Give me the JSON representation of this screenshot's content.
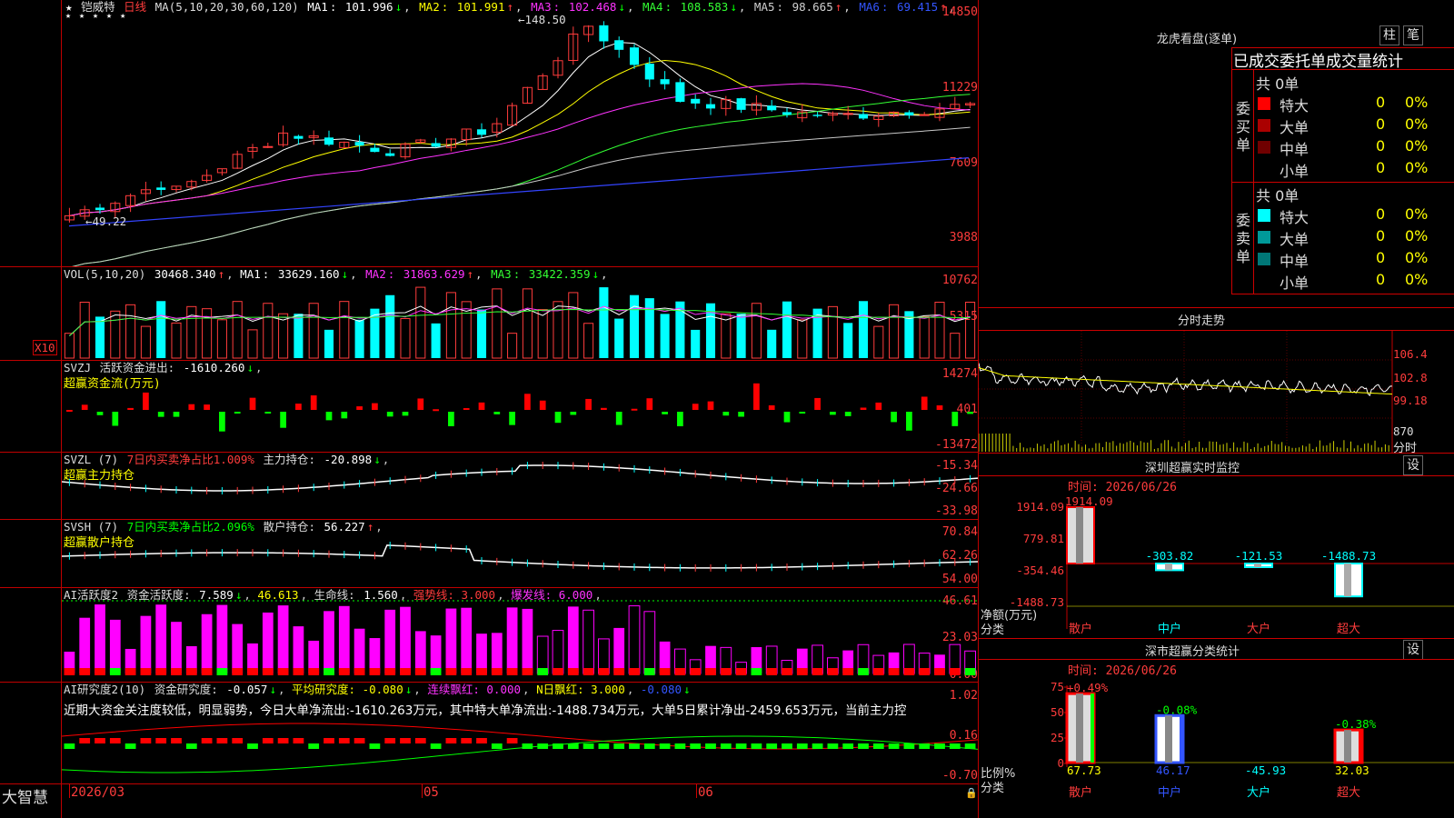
{
  "stock": {
    "name": "铠威特",
    "period": "日线",
    "ma_label": "MA(5,10,20,30,60,120)",
    "ma": [
      {
        "name": "MA1",
        "value": "101.996",
        "arrow": "↓",
        "color": "#ffffff"
      },
      {
        "name": "MA2",
        "value": "101.991",
        "arrow": "↑",
        "color": "#ffff00"
      },
      {
        "name": "MA3",
        "value": "102.468",
        "arrow": "↓",
        "color": "#ff33ff"
      },
      {
        "name": "MA4",
        "value": "108.583",
        "arrow": "↓",
        "color": "#33ff33"
      },
      {
        "name": "MA5",
        "value": "98.665",
        "arrow": "↑",
        "color": "#d0d0d0"
      },
      {
        "name": "MA6",
        "value": "69.415",
        "arrow": "↑",
        "color": "#3355ff"
      }
    ],
    "price_axis": [
      "14850",
      "11229",
      "7609",
      "3988"
    ],
    "high_label": "148.50",
    "low_label": "49.22",
    "stars": "★"
  },
  "vol": {
    "label": "VOL(5,10,20)",
    "value": "30468.340",
    "arrow": "↑",
    "ma": [
      {
        "name": "MA1",
        "value": "33629.160",
        "arrow": "↓",
        "color": "#ffffff"
      },
      {
        "name": "MA2",
        "value": "31863.629",
        "arrow": "↑",
        "color": "#ff33ff"
      },
      {
        "name": "MA3",
        "value": "33422.359",
        "arrow": "↓",
        "color": "#33ff33"
      }
    ],
    "axis": [
      "10762",
      "5315"
    ],
    "unit": "X10"
  },
  "svzj": {
    "label": "SVZJ",
    "title": "活跃资金进出:",
    "value": "-1610.260",
    "arrow": "↓",
    "sub": "超赢资金流(万元)",
    "axis": [
      "14274",
      "401",
      "-13472"
    ]
  },
  "svzl": {
    "label": "SVZL (7)",
    "desc": "7日内买卖净占比1.009%",
    "title": "主力持仓:",
    "value": "-20.898",
    "arrow": "↓",
    "sub": "超赢主力持仓",
    "axis": [
      "-15.34",
      "-24.66",
      "-33.98"
    ]
  },
  "svsh": {
    "label": "SVSH (7)",
    "desc": "7日内买卖净占比2.096%",
    "title": "散户持仓:",
    "value": "56.227",
    "arrow": "↑",
    "sub": "超赢散户持仓",
    "axis": [
      "70.84",
      "62.26",
      "54.00"
    ]
  },
  "ai1": {
    "label": "AI活跃度2",
    "title": "资金活跃度:",
    "value": "7.589",
    "arrow": "↓",
    "v2": "46.613",
    "life_label": "生命线:",
    "life_value": "1.560",
    "strong": "强势线: 3.000",
    "burst": "爆发线: 6.000",
    "axis": [
      "46.61",
      "23.03",
      "0.00"
    ]
  },
  "ai2": {
    "label": "AI研究度2(10)",
    "title": "资金研究度:",
    "value": "-0.057",
    "arrow": "↓",
    "avg": "平均研究度: -0.080",
    "cont": "连续飘红: 0.000",
    "nday": "N日飘红: 3.000",
    "last": "-0.080",
    "axis": [
      "1.02",
      "0.16",
      "-0.70"
    ],
    "comment": "近期大资金关注度较低，明显弱势，今日大单净流出:-1610.263万元，其中特大单净流出:-1488.734万元，大单5日累计净出-2459.653万元，当前主力控"
  },
  "footer": {
    "brand": "大智慧",
    "dates": [
      "2026/03",
      "05",
      "06"
    ]
  },
  "longhu": {
    "title": "龙虎看盘(逐单)",
    "btn1": "柱",
    "btn2": "笔",
    "subtitle": "已成交委托单成交量统计",
    "buy_label": "委买单",
    "sell_label": "委卖单",
    "buy_total": "共 0单",
    "sell_total": "共 0单",
    "buy_rows": [
      {
        "label": "特大",
        "count": "0",
        "pct": "0%",
        "color": "#ff0000"
      },
      {
        "label": "大单",
        "count": "0",
        "pct": "0%",
        "color": "#aa0000"
      },
      {
        "label": "中单",
        "count": "0",
        "pct": "0%",
        "color": "#700000"
      },
      {
        "label": "小单",
        "count": "0",
        "pct": "0%",
        "color": ""
      }
    ],
    "sell_rows": [
      {
        "label": "特大",
        "count": "0",
        "pct": "0%",
        "color": "#00ffff"
      },
      {
        "label": "大单",
        "count": "0",
        "pct": "0%",
        "color": "#009999"
      },
      {
        "label": "中单",
        "count": "0",
        "pct": "0%",
        "color": "#007777"
      },
      {
        "label": "小单",
        "count": "0",
        "pct": "0%",
        "color": ""
      }
    ]
  },
  "fenshi": {
    "title": "分时走势",
    "axis": [
      "106.4",
      "102.8",
      "99.18",
      "870"
    ],
    "bottom_label": "分时"
  },
  "sz_monitor": {
    "title": "深圳超赢实时监控",
    "btn": "设",
    "time": "时间: 2026/06/26",
    "axis": [
      "1914.09",
      "779.81",
      "-354.46",
      "-1488.73"
    ],
    "unit_label": "净额(万元)",
    "cat_label": "分类",
    "bars": [
      {
        "name": "散户",
        "value": 1914.09,
        "label": "1914.09"
      },
      {
        "name": "中户",
        "value": -303.82,
        "label": "-303.82"
      },
      {
        "name": "大户",
        "value": -121.53,
        "label": "-121.53"
      },
      {
        "name": "超大",
        "value": -1488.73,
        "label": "-1488.73"
      }
    ]
  },
  "sz_stats": {
    "title": "深市超赢分类统计",
    "btn": "设",
    "time": "时间: 2026/06/26",
    "axis": [
      "75",
      "50",
      "25",
      "0"
    ],
    "unit_label": "比例%",
    "cat_label": "分类",
    "bars": [
      {
        "name": "散户",
        "pct": 67.73,
        "top": "+0.49%",
        "bottom": "67.73"
      },
      {
        "name": "中户",
        "pct": 46.17,
        "top": "-0.08%",
        "bottom": "46.17"
      },
      {
        "name": "大户",
        "pct": 0,
        "top": "",
        "bottom": "-45.93"
      },
      {
        "name": "超大",
        "pct": 32.03,
        "top": "-0.38%",
        "bottom": "32.03"
      }
    ]
  }
}
